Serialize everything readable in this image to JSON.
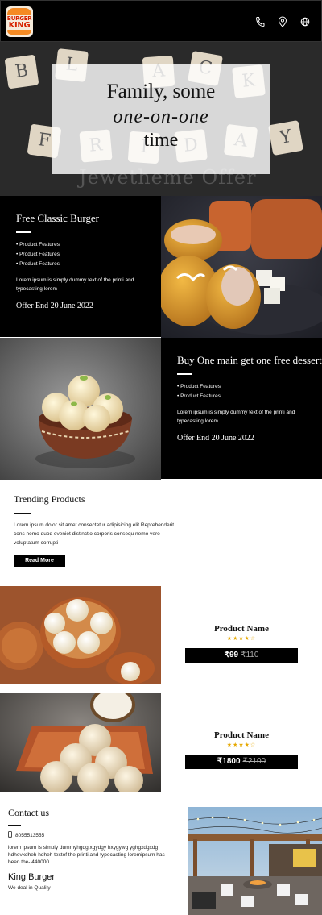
{
  "header": {
    "logo_line1": "BURGER",
    "logo_line2": "KING",
    "icons": [
      "phone-icon",
      "location-pin-icon",
      "globe-icon"
    ]
  },
  "hero": {
    "line1": "Family, some",
    "line2": "one-on-one",
    "line3": "time",
    "watermark": "Jewetheme Offer",
    "tiles": [
      "B",
      "L",
      "A",
      "C",
      "K",
      "F",
      "R",
      "I",
      "D",
      "A",
      "Y"
    ]
  },
  "offer1": {
    "title": "Free Classic Burger",
    "features": [
      "Product Features",
      "Product Features",
      "Product Features"
    ],
    "description": "Lorem ipsum is simply dummy text of the printi and typecasting lorem",
    "ends": "Offer End 20 June 2022"
  },
  "offer2": {
    "title": "Buy One main get one free dessert",
    "features": [
      "Product Features",
      "Product Features"
    ],
    "description": "Lorem ipsum is simply dummy text of the printi and typecasting lorem",
    "ends": "Offer End 20 June 2022"
  },
  "trending": {
    "title": "Trending Products",
    "text": "Lorem ipsum dolor sit amet consectetur adipisicing elit Reprehenderit cons nemo quod eveniet distinctio corporis consequ nemo vero voluptatum corrupti",
    "button": "Read More"
  },
  "products": [
    {
      "name": "Product Name",
      "rating_stars": "★★★★☆",
      "price": "₹99",
      "old_price": "₹110"
    },
    {
      "name": "Product Name",
      "rating_stars": "★★★★☆",
      "price": "₹1800",
      "old_price": "₹2100"
    }
  ],
  "contact": {
    "title": "Contact us",
    "phone": "8055513555",
    "text": "lorem ipsum is simply dummyhgdg xgydgy hxygywg yghgxdgxdg hdhevxdheh hdheh textof the printi and typecasting loremipsum has been the- 440000",
    "brand": "King Burger",
    "tagline": "We deal in Quality"
  },
  "colors": {
    "header_bg": "#000000",
    "accent": "#f58a23",
    "logo_text": "#d72300",
    "star": "#e6a800"
  }
}
